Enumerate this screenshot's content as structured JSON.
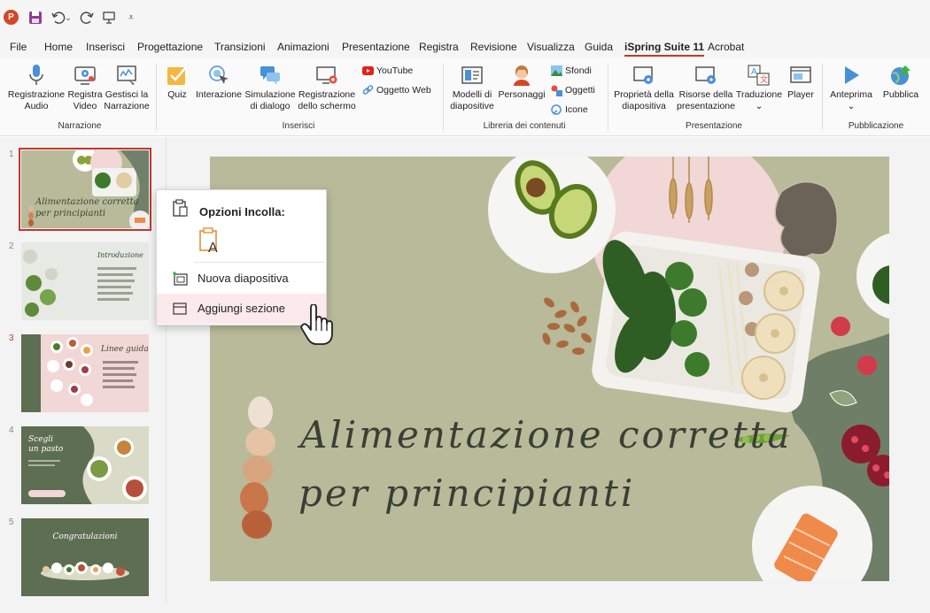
{
  "app": {
    "logo_letter": "P",
    "accent_color": "#c0392b"
  },
  "quick_access": {
    "icons": [
      "powerpoint-logo",
      "save-icon",
      "undo-icon",
      "redo-icon",
      "present-icon",
      "customize-icon"
    ]
  },
  "tabs": [
    {
      "label": "File"
    },
    {
      "label": "Home"
    },
    {
      "label": "Inserisci"
    },
    {
      "label": "Progettazione"
    },
    {
      "label": "Transizioni"
    },
    {
      "label": "Animazioni"
    },
    {
      "label": "Presentazione"
    },
    {
      "label": "Registra"
    },
    {
      "label": "Revisione"
    },
    {
      "label": "Visualizza"
    },
    {
      "label": "Guida"
    },
    {
      "label": "iSpring Suite 11",
      "active": true
    },
    {
      "label": "Acrobat"
    }
  ],
  "ribbon": {
    "narrazione": {
      "group_label": "Narrazione",
      "registra_audio": "Registrazione\nAudio",
      "registra_video": "Registra\nVideo",
      "gestisci": "Gestisci la\nNarrazione"
    },
    "inserisci": {
      "group_label": "Inserisci",
      "quiz": "Quiz",
      "interazione": "Interazione",
      "simulazione": "Simulazione\ndi dialogo",
      "registrazione_schermo": "Registrazione\ndello schermo",
      "youtube": "YouTube",
      "oggetto_web": "Oggetto Web"
    },
    "libreria": {
      "group_label": "Libreria dei contenuti",
      "modelli": "Modelli di\ndiapositive",
      "personaggi": "Personaggi",
      "sfondi": "Sfondi",
      "oggetti": "Oggetti",
      "icone": "Icone"
    },
    "presentazione": {
      "group_label": "Presentazione",
      "proprieta": "Proprietà della\ndiapositiva",
      "risorse": "Risorse della\npresentazione",
      "traduzione": "Traduzione\n⌄",
      "player": "Player"
    },
    "pubblicazione": {
      "group_label": "Pubblicazione",
      "anteprima": "Anteprima\n⌄",
      "pubblica": "Pubblica"
    }
  },
  "thumbnails": [
    {
      "number": "1",
      "title": "Alimentazione corretta\nper principianti",
      "selected": true
    },
    {
      "number": "2",
      "title": "Introduzione"
    },
    {
      "number": "3",
      "title": "Linee guida",
      "highlight": true
    },
    {
      "number": "4",
      "title": "Scegli\nun pasto"
    },
    {
      "number": "5",
      "title": "Congratulazioni"
    }
  ],
  "slide": {
    "title_line1": "Alimentazione corretta",
    "title_line2": "per principianti",
    "bg_color": "#b8ba9a",
    "accent_color": "#f1d7d5"
  },
  "context_menu": {
    "title": "Opzioni Incolla:",
    "items": [
      {
        "label": "Nuova diapositiva"
      },
      {
        "label": "Aggiungi sezione",
        "hover": true
      }
    ]
  }
}
